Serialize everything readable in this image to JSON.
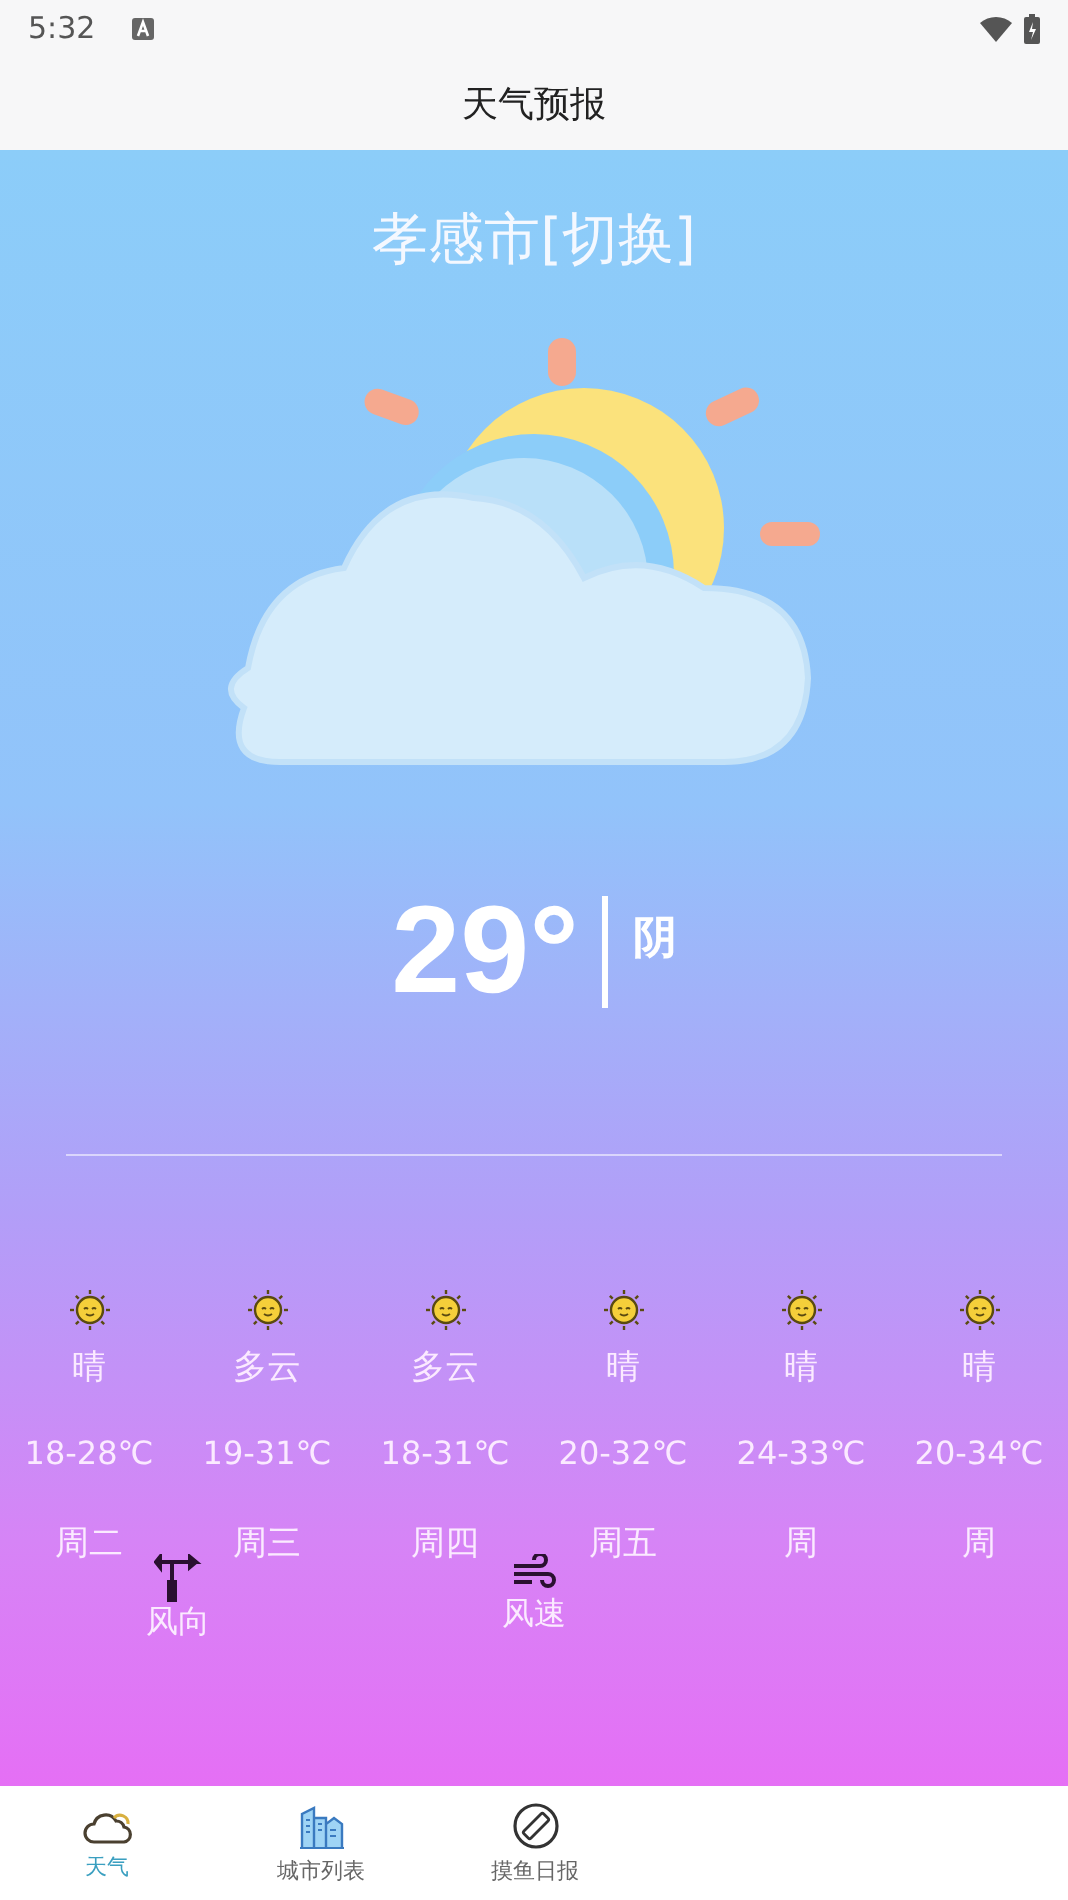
{
  "status_bar": {
    "time": "5:32"
  },
  "app_bar": {
    "title": "天气预报"
  },
  "current": {
    "city": "孝感市[切换]",
    "temperature": "29°",
    "condition": "阴"
  },
  "forecast": [
    {
      "condition": "晴",
      "range": "18-28℃",
      "day": "周二"
    },
    {
      "condition": "多云",
      "range": "19-31℃",
      "day": "周三"
    },
    {
      "condition": "多云",
      "range": "18-31℃",
      "day": "周四"
    },
    {
      "condition": "晴",
      "range": "20-32℃",
      "day": "周五"
    },
    {
      "condition": "晴",
      "range": "24-33℃",
      "day": "周"
    },
    {
      "condition": "晴",
      "range": "20-34℃",
      "day": "周"
    }
  ],
  "wind": [
    {
      "kind": "direction",
      "label": "风向"
    },
    {
      "kind": "speed",
      "label": "风速"
    }
  ],
  "nav": [
    {
      "kind": "weather",
      "label": "天气",
      "selected": true
    },
    {
      "kind": "cities",
      "label": "城市列表",
      "selected": false
    },
    {
      "kind": "daily",
      "label": "摸鱼日报",
      "selected": false
    }
  ]
}
